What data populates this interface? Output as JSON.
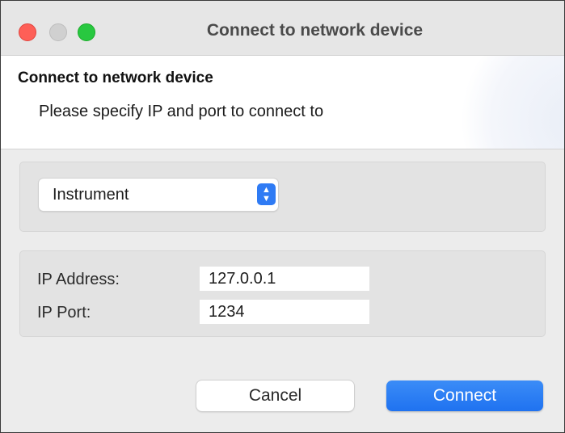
{
  "window": {
    "title": "Connect to network device",
    "traffic_lights": {
      "close_color": "#fe5f57",
      "minimize_color": "#d0d0d0",
      "zoom_color": "#28c840"
    }
  },
  "banner": {
    "heading": "Connect to network device",
    "description": "Please specify IP and port to connect to"
  },
  "device_type": {
    "selected": "Instrument",
    "icon": "up-down-chevron-icon",
    "accent": "#2f7bf4"
  },
  "fields": {
    "ip_address": {
      "label": "IP Address:",
      "value": "127.0.0.1"
    },
    "ip_port": {
      "label": "IP Port:",
      "value": "1234"
    }
  },
  "buttons": {
    "cancel": "Cancel",
    "connect": "Connect",
    "connect_color": "#1f72f0"
  }
}
